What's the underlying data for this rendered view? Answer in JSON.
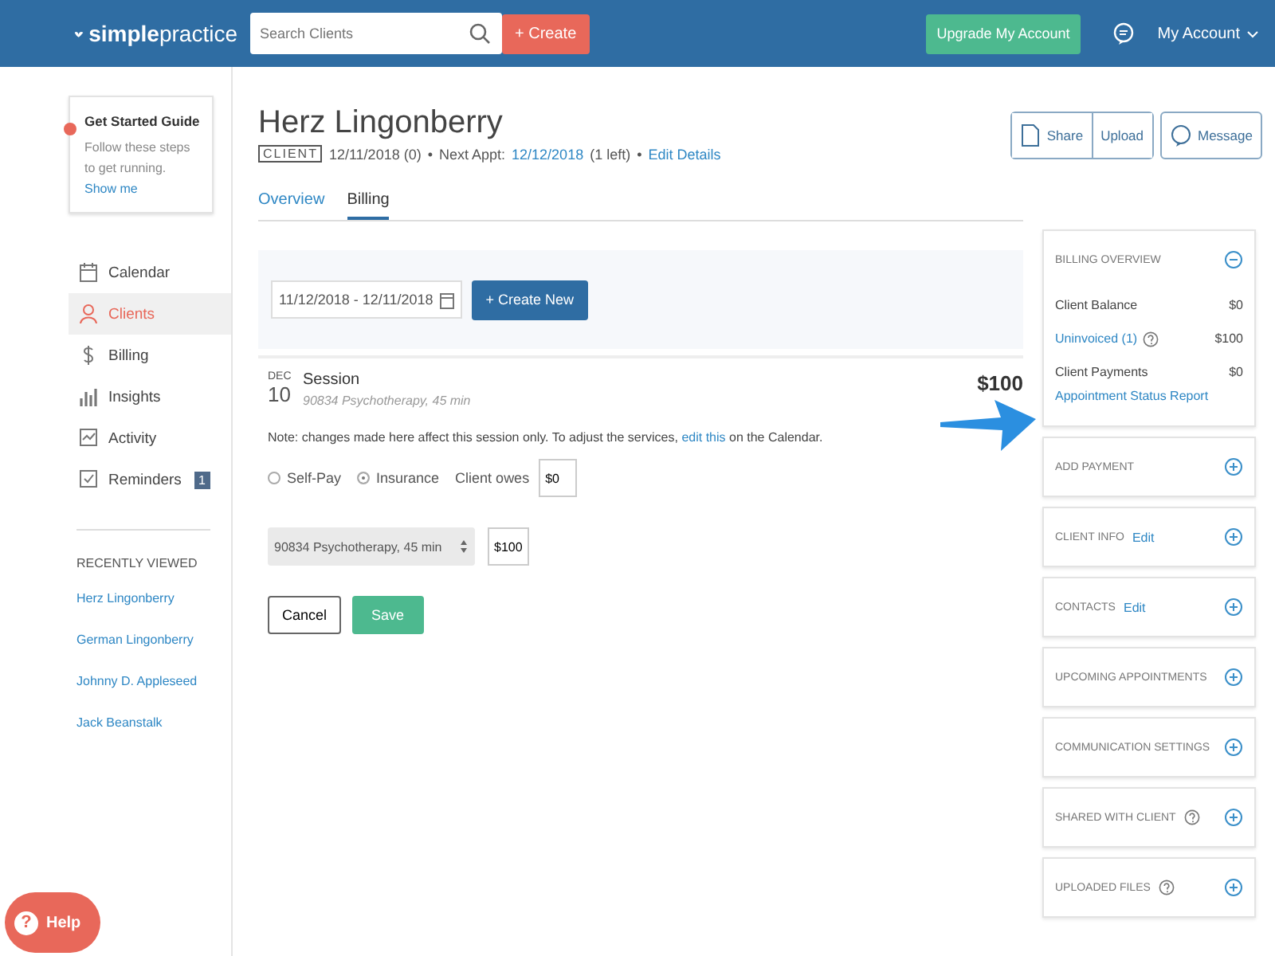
{
  "topbar": {
    "logo": "**simple**practice",
    "search": {
      "placeholder": "Search Clients"
    },
    "create_button": "+ Create",
    "upgrade_button": "Upgrade My Account",
    "account_menu": "My Account"
  },
  "sidebar": {
    "guide": {
      "title": "Get Started Guide",
      "text": "Follow these steps to get running.",
      "link": "Show me"
    },
    "nav": [
      {
        "label": "Calendar",
        "selected": false
      },
      {
        "label": "Clients",
        "selected": true
      },
      {
        "label": "Billing",
        "selected": false
      },
      {
        "label": "Insights",
        "selected": false
      },
      {
        "label": "Activity",
        "selected": false
      },
      {
        "label": "Reminders",
        "selected": false,
        "badge": "1"
      }
    ],
    "recent_heading": "RECENTLY VIEWED",
    "recent": [
      "Herz Lingonberry",
      "German Lingonberry",
      "Johnny D. Appleseed",
      "Jack Beanstalk"
    ]
  },
  "client": {
    "name": "Herz Lingonberry",
    "tag": "CLIENT",
    "first_date": "12/11/2018 (0)",
    "next_label": "Next Appt:",
    "next_date": "12/12/2018",
    "next_left": "(1 left)",
    "edit_details": "Edit Details",
    "bullets": [
      "•",
      "•"
    ]
  },
  "actions": [
    "Share",
    "Upload",
    "Message"
  ],
  "tabs": [
    {
      "label": "Overview",
      "selected": false
    },
    {
      "label": "Billing",
      "selected": true
    }
  ],
  "filter": {
    "date_range": "11/12/2018 - 12/11/2018",
    "create_new": "+ Create New"
  },
  "session": {
    "month": "DEC",
    "day": "10",
    "title": "Session",
    "service": "90834 Psychotherapy, 45 min",
    "amount": "$100"
  },
  "note": {
    "before": "Note: changes made here affect this session only. To adjust the services, ",
    "link": "edit this",
    "after": " on the Calendar."
  },
  "payer": {
    "options": [
      {
        "label": "Self-Pay",
        "selected": false
      },
      {
        "label": "Insurance",
        "selected": true
      }
    ],
    "owes_label": "Client owes",
    "owes_value": "$0"
  },
  "service_line": {
    "service": "90834 Psychotherapy, 45 min",
    "price": "$100"
  },
  "form_buttons": {
    "cancel": "Cancel",
    "save": "Save"
  },
  "panels": [
    {
      "title": "BILLING OVERVIEW",
      "expanded": true,
      "rows": [
        {
          "label": "Client Balance",
          "value": "$0",
          "link": false
        },
        {
          "label": "Uninvoiced (1)",
          "value": "$100",
          "link": true,
          "help": true
        },
        {
          "label": "Client Payments",
          "value": "$0",
          "link": false
        }
      ],
      "report_link": "Appointment Status Report"
    },
    {
      "title": "ADD PAYMENT",
      "expanded": false
    },
    {
      "title": "CLIENT INFO",
      "expanded": false,
      "edit": "Edit"
    },
    {
      "title": "CONTACTS",
      "expanded": false,
      "edit": "Edit"
    },
    {
      "title": "UPCOMING APPOINTMENTS",
      "expanded": false
    },
    {
      "title": "COMMUNICATION SETTINGS",
      "expanded": false
    },
    {
      "title": "SHARED WITH CLIENT",
      "expanded": false,
      "help": true
    },
    {
      "title": "UPLOADED FILES",
      "expanded": false,
      "help": true
    }
  ],
  "help_button": {
    "glyph": "?",
    "label": "Help"
  }
}
